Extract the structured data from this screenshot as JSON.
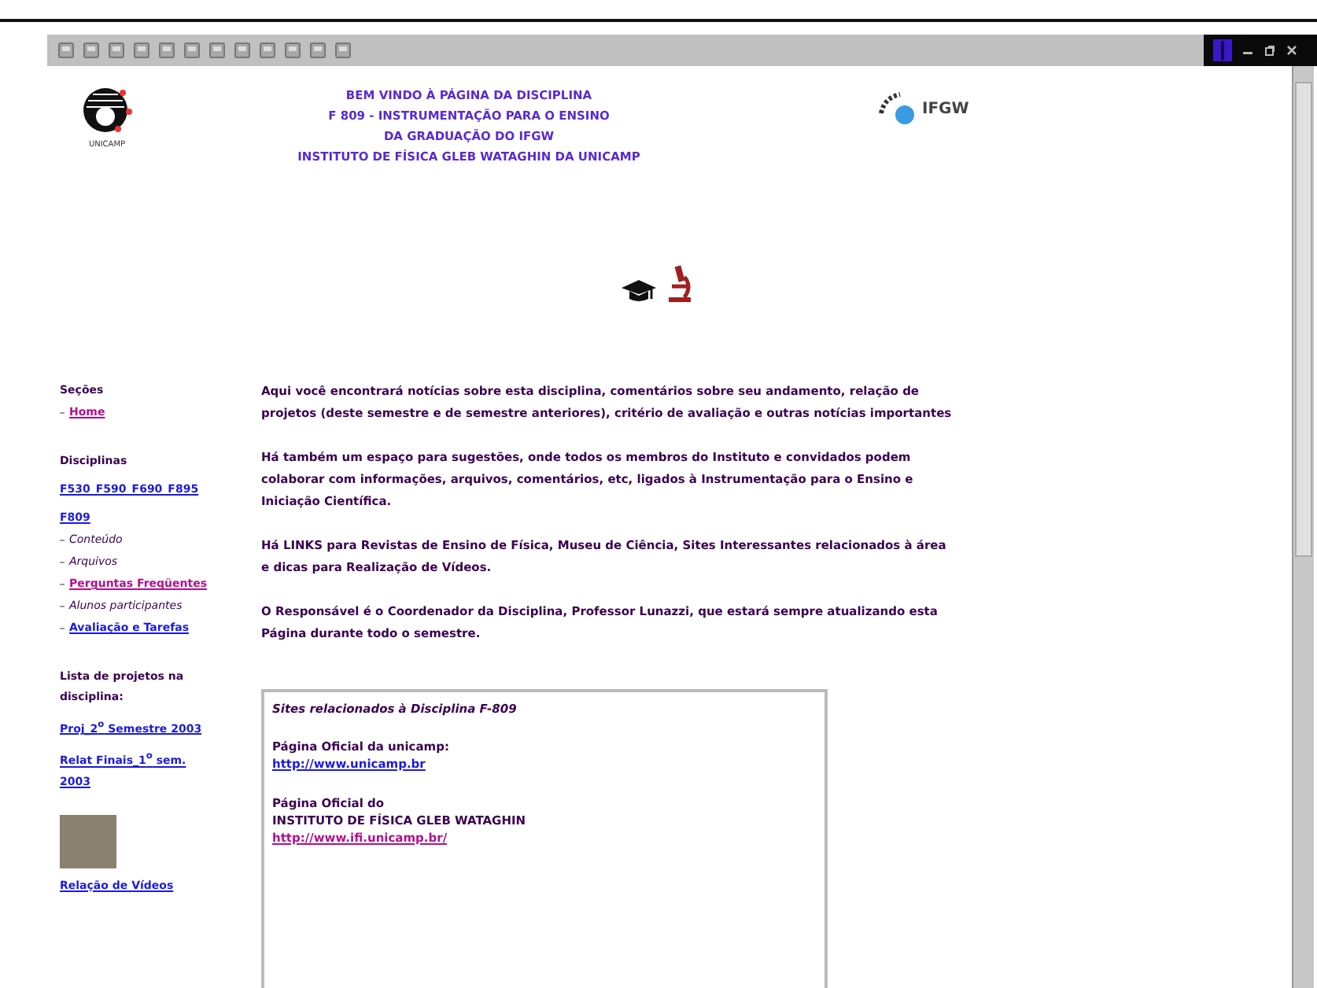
{
  "header": {
    "logo_left_text": "UNICAMP",
    "title_lines": [
      "BEM VINDO À PÁGINA DA DISCIPLINA",
      "F 809 - INSTRUMENTAÇÃO PARA O ENSINO",
      "DA GRADUAÇÃO DO IFGW",
      "INSTITUTO DE FÍSICA GLEB WATAGHIN DA UNICAMP"
    ],
    "logo_right_text": "IFGW"
  },
  "sidebar": [
    {
      "kind": "heading",
      "text": "Seções"
    },
    {
      "kind": "bullet-link",
      "text": "Home",
      "visited": true
    },
    {
      "kind": "heading",
      "text": "Disciplinas"
    },
    {
      "kind": "link",
      "text": "F530_F590_F690_F895",
      "visited": false
    },
    {
      "kind": "link",
      "text": "F809",
      "visited": false
    },
    {
      "kind": "bullet",
      "text": "Conteúdo"
    },
    {
      "kind": "bullet",
      "text": "Arquivos"
    },
    {
      "kind": "bullet-link",
      "text": "Perguntas Freqüentes",
      "visited": true
    },
    {
      "kind": "bullet",
      "text": "Alunos participantes"
    },
    {
      "kind": "bullet-link",
      "text": "Avaliação e Tarefas",
      "visited": false
    },
    {
      "kind": "heading",
      "text": "Lista de projetos na disciplina:"
    },
    {
      "kind": "link",
      "text": "Proj_2$^{o}$ Semestre 2003",
      "visited": false
    },
    {
      "kind": "link",
      "text": "Relat Finais_1$^{o}$ sem. 2003",
      "visited": false
    },
    {
      "kind": "photo"
    },
    {
      "kind": "link",
      "text": "Relação de Vídeos",
      "visited": false
    }
  ],
  "paragraphs": [
    "Aqui você encontrará notícias sobre esta disciplina, comentários sobre seu andamento, relação de projetos (deste semestre e de semestre anteriores), critério de avaliação e outras notícias importantes",
    "Há também um espaço para sugestões, onde todos os membros do Instituto e convidados podem colaborar com informações, arquivos, comentários, etc, ligados à Instrumentação para o Ensino e Iniciação Científica.",
    "Há LINKS para Revistas de Ensino de Física, Museu de Ciência, Sites Interessantes relacionados à área e dicas para Realização de Vídeos.",
    "O Responsável é o Coordenador da Disciplina, Professor Lunazzi, que estará sempre atualizando esta Página durante todo o semestre."
  ],
  "sites_box": {
    "title": "Sites relacionados à Disciplina F-809",
    "entries": [
      {
        "label_lines": [
          "Página Oficial da unicamp:"
        ],
        "url": "http://www.unicamp.br",
        "visited": false
      },
      {
        "label_lines": [
          "Página Oficial do",
          "INSTITUTO DE FÍSICA GLEB WATAGHIN"
        ],
        "url": "http://www.ifi.unicamp.br/",
        "visited": true
      }
    ]
  }
}
